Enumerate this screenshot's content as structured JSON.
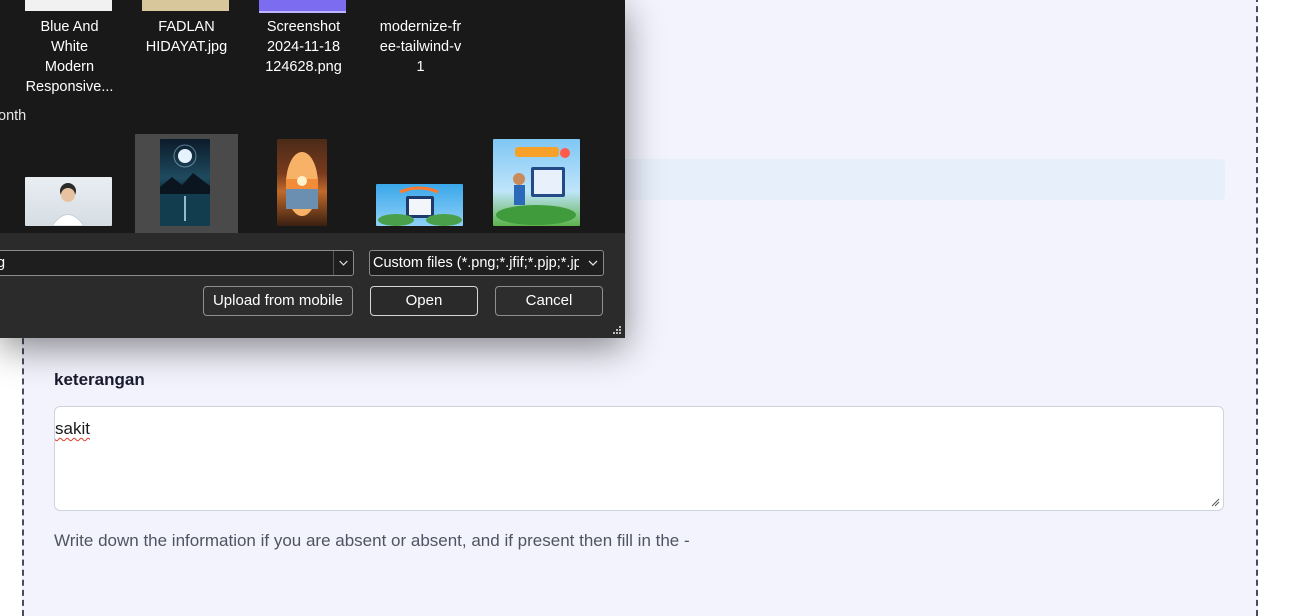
{
  "dialog": {
    "files_top": [
      {
        "name": "Blue And White Modern Responsive...",
        "lines": [
          "Blue And",
          "White",
          "Modern",
          "Responsive..."
        ]
      },
      {
        "name": "FADLAN HIDAYAT.jpg",
        "lines": [
          "FADLAN",
          "HIDAYAT.jpg"
        ]
      },
      {
        "name": "Screenshot 2024-11-18 124628.png",
        "lines": [
          "Screenshot",
          "2024-11-18",
          "124628.png"
        ]
      },
      {
        "name": "modernize-free-tailwind-v1",
        "lines": [
          "modernize-fr",
          "ee-tailwind-v",
          "1"
        ]
      }
    ],
    "group_label": "onth",
    "thumbnails": [
      {
        "subject": "student portrait photo",
        "selected": false
      },
      {
        "subject": "night lake moon painting",
        "selected": true
      },
      {
        "subject": "sunset cave painting",
        "selected": false
      },
      {
        "subject": "tablet illustration banner",
        "selected": false
      },
      {
        "subject": "colorful web illustration",
        "selected": false
      }
    ],
    "filename_value": "g",
    "filetype_value": "Custom files (*.png;*.jfif;*.pjp;*.jpg;*.jpeg)",
    "upload_label": "Upload from mobile",
    "open_label": "Open",
    "cancel_label": "Cancel"
  },
  "form": {
    "field_label": "keterangan",
    "field_value": "sakit",
    "helper_text": "Write down the information if you are absent or absent, and if present then fill in the -"
  },
  "colors": {
    "dialog_bg": "#1c1c1c",
    "dialog_footer": "#2b2b2b",
    "page_panel": "#f3f3fd",
    "dashed_border": "#4a4a63",
    "spell_underline": "#e0392b"
  }
}
